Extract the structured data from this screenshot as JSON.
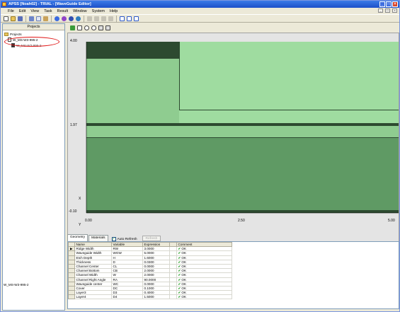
{
  "titlebar": {
    "title": "APSS [Noah02] - TRIAL - [WaveGuide Editor]",
    "buttons": [
      "_",
      "□",
      "×"
    ]
  },
  "menubar": {
    "items": [
      "File",
      "Edit",
      "View",
      "Task",
      "Result",
      "Window",
      "System",
      "Help"
    ],
    "mdi_buttons": [
      "_",
      "□",
      "×"
    ]
  },
  "projects": {
    "header": "Projects",
    "root": "Projects",
    "items": [
      "W_MS-W3-995-2",
      "W_MS-W3-995-2"
    ],
    "status": "W_MS-W3-995-2"
  },
  "plot": {
    "y_ticks": [
      "4.00",
      "1.97",
      "-0.10"
    ],
    "x_ticks": [
      "0.00",
      "2.50",
      "5.00"
    ],
    "x_axis": "Y",
    "y_axis": "X",
    "colors": {
      "background": "#e4e4e4",
      "dark": "#2d4a30",
      "light": "#9fdca0",
      "medium": "#8fcc90",
      "deep": "#5f9a64"
    }
  },
  "bottom": {
    "tabs": [
      "Geometry",
      "Materials"
    ],
    "auto_refresh_label": "Auto Refresh",
    "auto_refresh_checked": "✓",
    "refresh_button": "Refresh",
    "columns": [
      "Name",
      "Variable",
      "Expression",
      "Comment"
    ],
    "rows": [
      {
        "name": "Ridge Width",
        "var": "RW",
        "expr": "3.0000",
        "comment": "OK"
      },
      {
        "name": "Waveguide Width",
        "var": "WGW",
        "expr": "5.0000",
        "comment": "OK"
      },
      {
        "name": "Etch Depth",
        "var": "H",
        "expr": "1.6000",
        "comment": "OK"
      },
      {
        "name": "Thickness",
        "var": "D",
        "expr": "0.0300",
        "comment": "OK"
      },
      {
        "name": "Channel Center",
        "var": "CL",
        "expr": "0.0000",
        "comment": "OK"
      },
      {
        "name": "Channel Bottom",
        "var": "CB",
        "expr": "2.0000",
        "comment": "OK"
      },
      {
        "name": "Channel Width",
        "var": "W",
        "expr": "2.0000",
        "comment": "OK"
      },
      {
        "name": "Channel Right Angle",
        "var": "RA",
        "expr": "90.0000",
        "comment": "OK"
      },
      {
        "name": "Waveguide center",
        "var": "WC",
        "expr": "0.0000",
        "comment": "OK"
      },
      {
        "name": "Cover",
        "var": "DC",
        "expr": "0.1000",
        "comment": "OK"
      },
      {
        "name": "Layer3",
        "var": "D3",
        "expr": "0.4000",
        "comment": "OK"
      },
      {
        "name": "Layer4",
        "var": "D4",
        "expr": "1.5000",
        "comment": "OK"
      }
    ]
  }
}
